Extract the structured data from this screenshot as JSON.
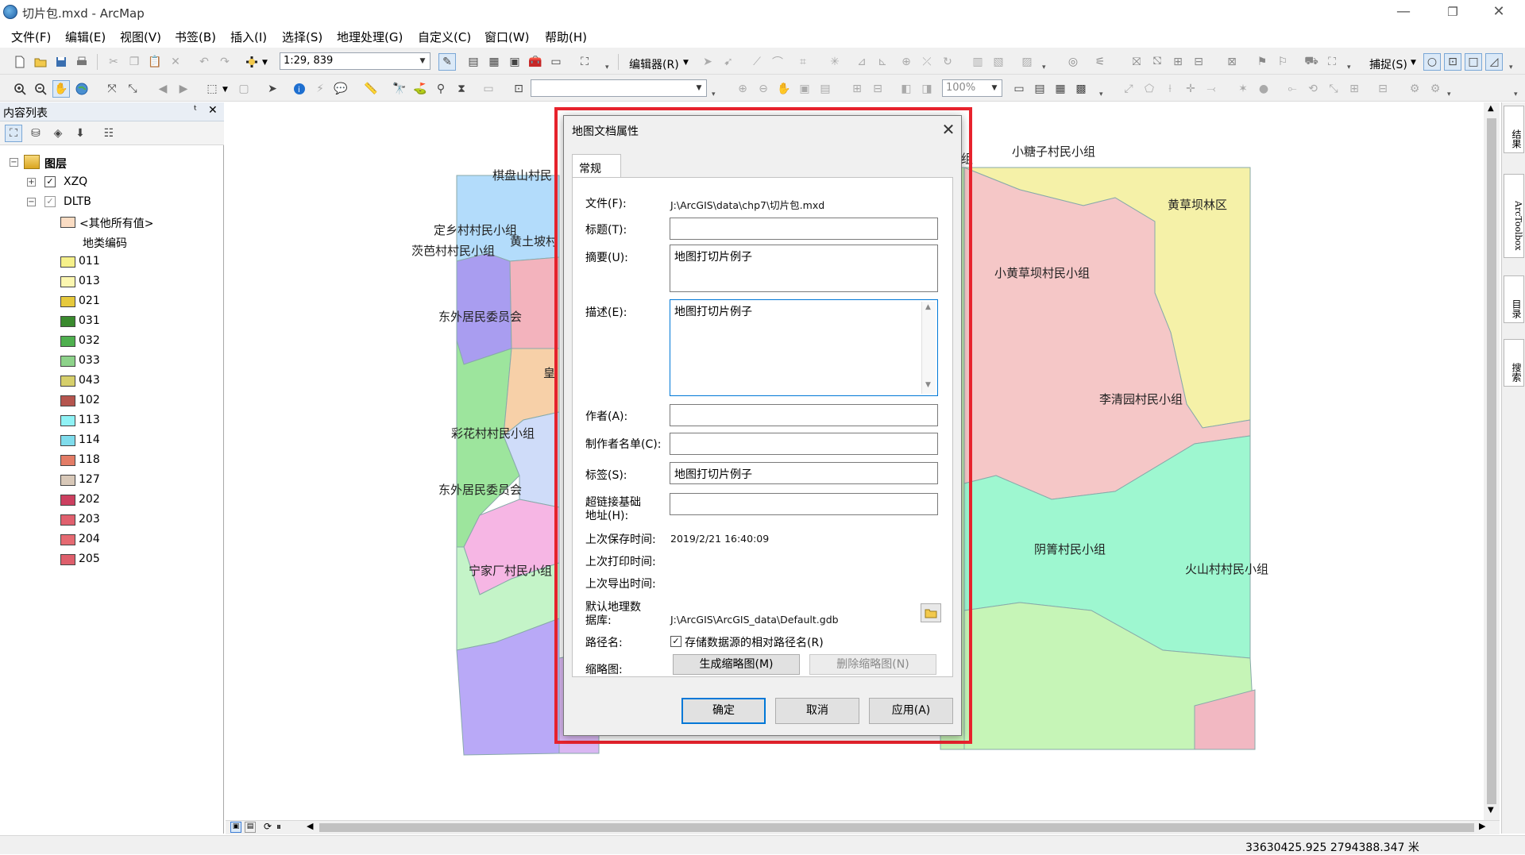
{
  "window": {
    "title": "切片包.mxd - ArcMap",
    "minimize": "—",
    "restore": "❐",
    "close": "✕"
  },
  "menu": [
    "文件(F)",
    "编辑(E)",
    "视图(V)",
    "书签(B)",
    "插入(I)",
    "选择(S)",
    "地理处理(G)",
    "自定义(C)",
    "窗口(W)",
    "帮助(H)"
  ],
  "toolbar": {
    "scale": "1:29, 839",
    "editor_label": "编辑器(R)",
    "snap_label": "捕捉(S)",
    "zoom_percent": "100%"
  },
  "toc": {
    "title": "内容列表",
    "pin": "ᵗ",
    "close": "✕",
    "root_label": "图层",
    "layers": [
      {
        "name": "XZQ",
        "checked": true,
        "expander": "+"
      },
      {
        "name": "DLTB",
        "checked": true,
        "expander": "−"
      }
    ],
    "other_values_label": "<其他所有值>",
    "field_label": "地类编码",
    "legend": [
      {
        "code": "011",
        "color": "#f5f08a"
      },
      {
        "code": "013",
        "color": "#fbf6b0"
      },
      {
        "code": "021",
        "color": "#e6c93c"
      },
      {
        "code": "031",
        "color": "#3a8a2e"
      },
      {
        "code": "032",
        "color": "#4fb04f"
      },
      {
        "code": "033",
        "color": "#8dd28a"
      },
      {
        "code": "043",
        "color": "#d6cf6b"
      },
      {
        "code": "102",
        "color": "#b5554e"
      },
      {
        "code": "113",
        "color": "#8ff2f5"
      },
      {
        "code": "114",
        "color": "#7fdcec"
      },
      {
        "code": "118",
        "color": "#e37c66"
      },
      {
        "code": "127",
        "color": "#d8c8b8"
      },
      {
        "code": "202",
        "color": "#cc4060"
      },
      {
        "code": "203",
        "color": "#e0606e"
      },
      {
        "code": "204",
        "color": "#e56a72"
      },
      {
        "code": "205",
        "color": "#de5f6c"
      }
    ]
  },
  "map_labels": [
    "棋盘山村民",
    "定乡村村民小组",
    "黄土坡村",
    "茨芭村村民小组",
    "东外居民委员会",
    "皇",
    "彩花村村民小组",
    "东外居民委员会",
    "宁家厂村民小组",
    "小糖子村民小组",
    "黄草坝林区",
    "小黄草坝村民小组",
    "李清园村民小组",
    "阴箐村民小组",
    "火山村村民小组",
    "组"
  ],
  "dialog": {
    "title": "地图文档属性",
    "close": "✕",
    "tab": "常规",
    "file_label": "文件(F):",
    "file_value": "J:\\ArcGIS\\data\\chp7\\切片包.mxd",
    "title_label": "标题(T):",
    "title_value": "",
    "summary_label": "摘要(U):",
    "summary_value": "地图打切片例子",
    "description_label": "描述(E):",
    "description_value": "地图打切片例子",
    "author_label": "作者(A):",
    "author_value": "",
    "credits_label": "制作者名单(C):",
    "credits_value": "",
    "tags_label": "标签(S):",
    "tags_value": "地图打切片例子",
    "hyperlink_label_1": "超链接基础",
    "hyperlink_label_2": "地址(H):",
    "hyperlink_value": "",
    "last_saved_label": "上次保存时间:",
    "last_saved_value": "2019/2/21 16:40:09",
    "last_printed_label": "上次打印时间:",
    "last_exported_label": "上次导出时间:",
    "default_gdb_label_1": "默认地理数",
    "default_gdb_label_2": "据库:",
    "default_gdb_value": "J:\\ArcGIS\\ArcGIS_data\\Default.gdb",
    "pathnames_label": "路径名:",
    "relative_paths_label": "存储数据源的相对路径名(R)",
    "relative_paths_checked": true,
    "thumbnail_label": "缩略图:",
    "make_thumbnail": "生成缩略图(M)",
    "delete_thumbnail": "删除缩略图(N)",
    "ok": "确定",
    "cancel": "取消",
    "apply": "应用(A)"
  },
  "right_dock": [
    "结果",
    "ArcToolbox",
    "目录",
    "搜索"
  ],
  "status": {
    "coordinates": "33630425.925  2794388.347 米"
  }
}
